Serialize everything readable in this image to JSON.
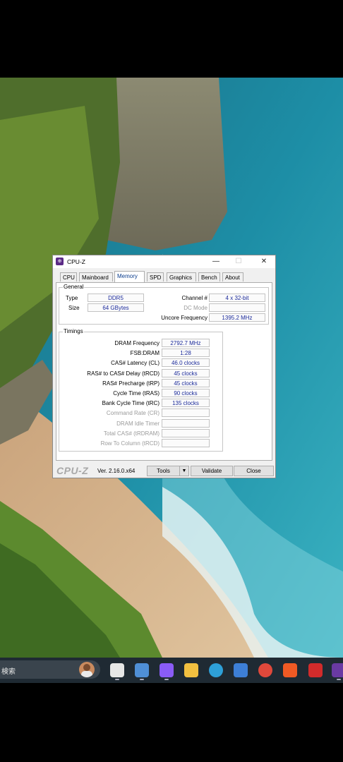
{
  "window": {
    "title": "CPU-Z",
    "controls": {
      "min": "—",
      "max": "☐",
      "close": "✕"
    }
  },
  "tabs": [
    {
      "label": "CPU"
    },
    {
      "label": "Mainboard"
    },
    {
      "label": "Memory",
      "active": true
    },
    {
      "label": "SPD"
    },
    {
      "label": "Graphics"
    },
    {
      "label": "Bench"
    },
    {
      "label": "About"
    }
  ],
  "general": {
    "legend": "General",
    "type_label": "Type",
    "type_value": "DDR5",
    "size_label": "Size",
    "size_value": "64 GBytes",
    "channel_label": "Channel #",
    "channel_value": "4 x 32-bit",
    "dcmode_label": "DC Mode",
    "dcmode_value": "",
    "uncore_label": "Uncore Frequency",
    "uncore_value": "1395.2 MHz"
  },
  "timings": {
    "legend": "Timings",
    "rows": [
      {
        "label": "DRAM Frequency",
        "value": "2792.7 MHz",
        "enabled": true
      },
      {
        "label": "FSB:DRAM",
        "value": "1:28",
        "enabled": true
      },
      {
        "label": "CAS# Latency (CL)",
        "value": "46.0 clocks",
        "enabled": true
      },
      {
        "label": "RAS# to CAS# Delay (tRCD)",
        "value": "45 clocks",
        "enabled": true
      },
      {
        "label": "RAS# Precharge (tRP)",
        "value": "45 clocks",
        "enabled": true
      },
      {
        "label": "Cycle Time (tRAS)",
        "value": "90 clocks",
        "enabled": true
      },
      {
        "label": "Bank Cycle Time (tRC)",
        "value": "135 clocks",
        "enabled": true
      },
      {
        "label": "Command Rate (CR)",
        "value": "",
        "enabled": false
      },
      {
        "label": "DRAM Idle Timer",
        "value": "",
        "enabled": false
      },
      {
        "label": "Total CAS# (tRDRAM)",
        "value": "",
        "enabled": false
      },
      {
        "label": "Row To Column (tRCD)",
        "value": "",
        "enabled": false
      }
    ]
  },
  "footer": {
    "brand": "CPU-Z",
    "version": "Ver. 2.16.0.x64",
    "tools_label": "Tools",
    "tools_arrow": "▼",
    "validate_label": "Validate",
    "close_label": "Close"
  },
  "taskbar": {
    "search_text": "検索",
    "icons": [
      {
        "name": "task-view-icon",
        "color": "#e6e6e6"
      },
      {
        "name": "settings-icon",
        "color": "#4f8fd6"
      },
      {
        "name": "copilot-icon",
        "color": "#8a5cf6"
      },
      {
        "name": "file-explorer-icon",
        "color": "#f2c040"
      },
      {
        "name": "edge-icon",
        "color": "#2ea0d8"
      },
      {
        "name": "store-icon",
        "color": "#3d7fd6"
      },
      {
        "name": "chrome-icon",
        "color": "#e0483b"
      },
      {
        "name": "brave-icon",
        "color": "#f05a24"
      },
      {
        "name": "app-red-icon",
        "color": "#d22b2b"
      },
      {
        "name": "cpuz-taskbar-icon",
        "color": "#6a3aa3"
      }
    ]
  }
}
